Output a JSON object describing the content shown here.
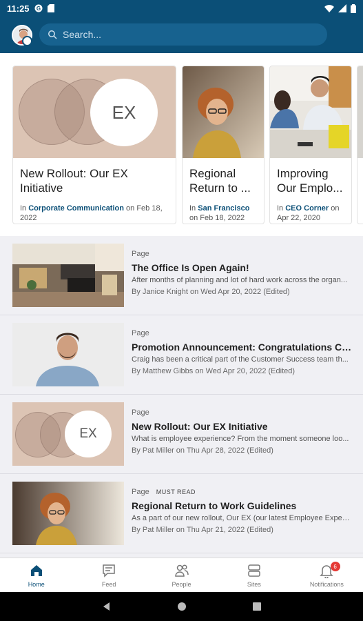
{
  "status_bar": {
    "time": "11:25"
  },
  "header": {
    "search_placeholder": "Search..."
  },
  "featured": [
    {
      "title": "New Rollout: Our EX Initiative",
      "prefix": "In ",
      "site": "Corporate Communication",
      "date": " on Feb 18, 2022",
      "image": "ex-logo",
      "ex_text": "EX"
    },
    {
      "title": "Regional Return to ...",
      "prefix": "In ",
      "site": "San Francisco",
      "date": " on Feb 18, 2022",
      "image": "woman-curly-hair-photo"
    },
    {
      "title": "Improving Our Emplo...",
      "prefix": "In ",
      "site": "CEO Corner",
      "date": " on Apr 22, 2020",
      "image": "office-meeting-photo"
    }
  ],
  "list": [
    {
      "kind": "Page",
      "must_read": "",
      "title": "The Office Is Open Again!",
      "desc": "After months of planning and lot of hard work across the organ...",
      "by": "By Janice Knight on Wed Apr 20, 2022 (Edited)",
      "image": "office-photo"
    },
    {
      "kind": "Page",
      "must_read": "",
      "title": "Promotion Announcement: Congratulations Craig...",
      "desc": "Craig has been a critical part of the Customer Success team th...",
      "by": "By Matthew Gibbs on Wed Apr 20, 2022 (Edited)",
      "image": "man-smiling-photo"
    },
    {
      "kind": "Page",
      "must_read": "",
      "title": "New Rollout: Our EX Initiative",
      "desc": "What is employee experience? From the moment someone loo...",
      "by": "By Pat Miller on Thu Apr 28, 2022 (Edited)",
      "image": "ex-logo",
      "ex_text": "EX"
    },
    {
      "kind": "Page",
      "must_read": "MUST READ",
      "title": "Regional Return to Work Guidelines",
      "desc": "As a part of our new rollout, Our EX (our latest Employee Experi...",
      "by": "By Pat Miller on Thu Apr 21, 2022 (Edited)",
      "image": "woman-curly-hair-photo"
    }
  ],
  "bottom_nav": [
    {
      "label": "Home",
      "icon": "home-icon",
      "active": true
    },
    {
      "label": "Feed",
      "icon": "feed-icon"
    },
    {
      "label": "People",
      "icon": "people-icon"
    },
    {
      "label": "Sites",
      "icon": "sites-icon"
    },
    {
      "label": "Notifications",
      "icon": "bell-icon",
      "badge": "6"
    }
  ],
  "colors": {
    "brand": "#0b4f77",
    "badge": "#e53935",
    "ex_bg": "#dcc4b4"
  }
}
